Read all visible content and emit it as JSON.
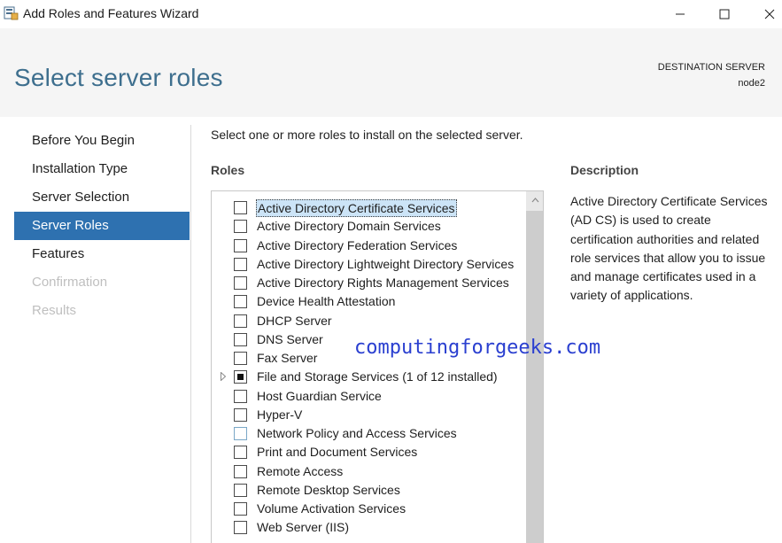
{
  "window": {
    "title": "Add Roles and Features Wizard",
    "icon": "server-manager-icon"
  },
  "header": {
    "page_title": "Select server roles",
    "destination_label": "DESTINATION SERVER",
    "destination_node": "node2"
  },
  "nav": {
    "items": [
      {
        "label": "Before You Begin",
        "state": "normal"
      },
      {
        "label": "Installation Type",
        "state": "normal"
      },
      {
        "label": "Server Selection",
        "state": "normal"
      },
      {
        "label": "Server Roles",
        "state": "active"
      },
      {
        "label": "Features",
        "state": "normal"
      },
      {
        "label": "Confirmation",
        "state": "disabled"
      },
      {
        "label": "Results",
        "state": "disabled"
      }
    ]
  },
  "main": {
    "intro": "Select one or more roles to install on the selected server.",
    "roles_heading": "Roles",
    "roles": [
      {
        "label": "Active Directory Certificate Services",
        "checked": false,
        "selected": true,
        "expandable": false
      },
      {
        "label": "Active Directory Domain Services",
        "checked": false,
        "selected": false,
        "expandable": false
      },
      {
        "label": "Active Directory Federation Services",
        "checked": false,
        "selected": false,
        "expandable": false
      },
      {
        "label": "Active Directory Lightweight Directory Services",
        "checked": false,
        "selected": false,
        "expandable": false
      },
      {
        "label": "Active Directory Rights Management Services",
        "checked": false,
        "selected": false,
        "expandable": false
      },
      {
        "label": "Device Health Attestation",
        "checked": false,
        "selected": false,
        "expandable": false
      },
      {
        "label": "DHCP Server",
        "checked": false,
        "selected": false,
        "expandable": false
      },
      {
        "label": "DNS Server",
        "checked": false,
        "selected": false,
        "expandable": false
      },
      {
        "label": "Fax Server",
        "checked": false,
        "selected": false,
        "expandable": false
      },
      {
        "label": "File and Storage Services (1 of 12 installed)",
        "checked": "partial",
        "selected": false,
        "expandable": true
      },
      {
        "label": "Host Guardian Service",
        "checked": false,
        "selected": false,
        "expandable": false
      },
      {
        "label": "Hyper-V",
        "checked": false,
        "selected": false,
        "expandable": false
      },
      {
        "label": "Network Policy and Access Services",
        "checked": false,
        "selected": false,
        "expandable": false,
        "hover": true
      },
      {
        "label": "Print and Document Services",
        "checked": false,
        "selected": false,
        "expandable": false
      },
      {
        "label": "Remote Access",
        "checked": false,
        "selected": false,
        "expandable": false
      },
      {
        "label": "Remote Desktop Services",
        "checked": false,
        "selected": false,
        "expandable": false
      },
      {
        "label": "Volume Activation Services",
        "checked": false,
        "selected": false,
        "expandable": false
      },
      {
        "label": "Web Server (IIS)",
        "checked": false,
        "selected": false,
        "expandable": false
      }
    ]
  },
  "description": {
    "heading": "Description",
    "body": "Active Directory Certificate Services (AD CS) is used to create certification authorities and related role services that allow you to issue and manage certificates used in a variety of applications."
  },
  "watermark": "computingforgeeks.com",
  "colors": {
    "accent": "#2e71b0",
    "title": "#3e6f8e",
    "watermark": "#2a3fd0"
  }
}
